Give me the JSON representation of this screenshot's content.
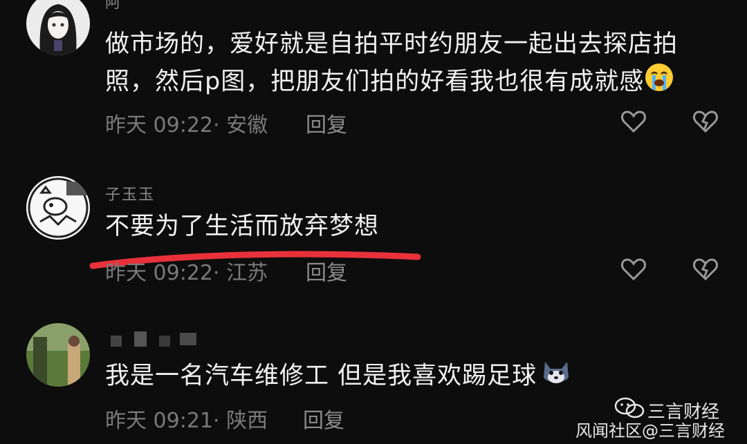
{
  "comments": [
    {
      "name": "阿",
      "text_line1": "做市场的，爱好就是自拍平时约朋友一起出去探店拍",
      "text_line2": "照，然后p图，把朋友们拍的好看我也很有成就感",
      "emoji": "loudly-crying-face",
      "time": "昨天 09:22",
      "location": "· 安徽",
      "reply": "回复"
    },
    {
      "name": "子玉玉",
      "text_line1": "不要为了生活而放弃梦想",
      "time": "昨天 09:22",
      "location": "· 江苏",
      "reply": "回复",
      "highlight_color": "#e8313a"
    },
    {
      "text_line1": "我是一名汽车维修工 但是我喜欢踢足球",
      "emoji": "wolf-face",
      "time": "昨天 09:21",
      "location": "· 陕西",
      "reply": "回复"
    }
  ],
  "watermark": {
    "wechat_account": "三言财经",
    "source": "风闻社区@三言财经"
  },
  "colors": {
    "background": "#0d0d0d",
    "meta_text": "#7a7a7a",
    "highlight": "#e8313a"
  }
}
